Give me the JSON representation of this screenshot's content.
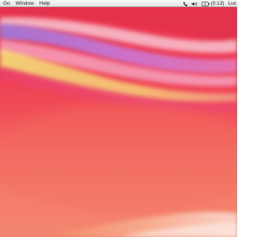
{
  "menubar": {
    "menus": [
      "Go",
      "Window",
      "Help"
    ],
    "status": {
      "icons": [
        "phone-icon",
        "volume-icon",
        "battery-icon"
      ],
      "battery": "(0:13)",
      "user": "Luc"
    }
  },
  "colors": {
    "menubar_bg": "#ececec",
    "wallpaper_base": "#ee3a52",
    "wallpaper_light": "#f6b0b6",
    "wallpaper_violet": "#a870d9",
    "wallpaper_yellow": "#f5dd6a"
  }
}
